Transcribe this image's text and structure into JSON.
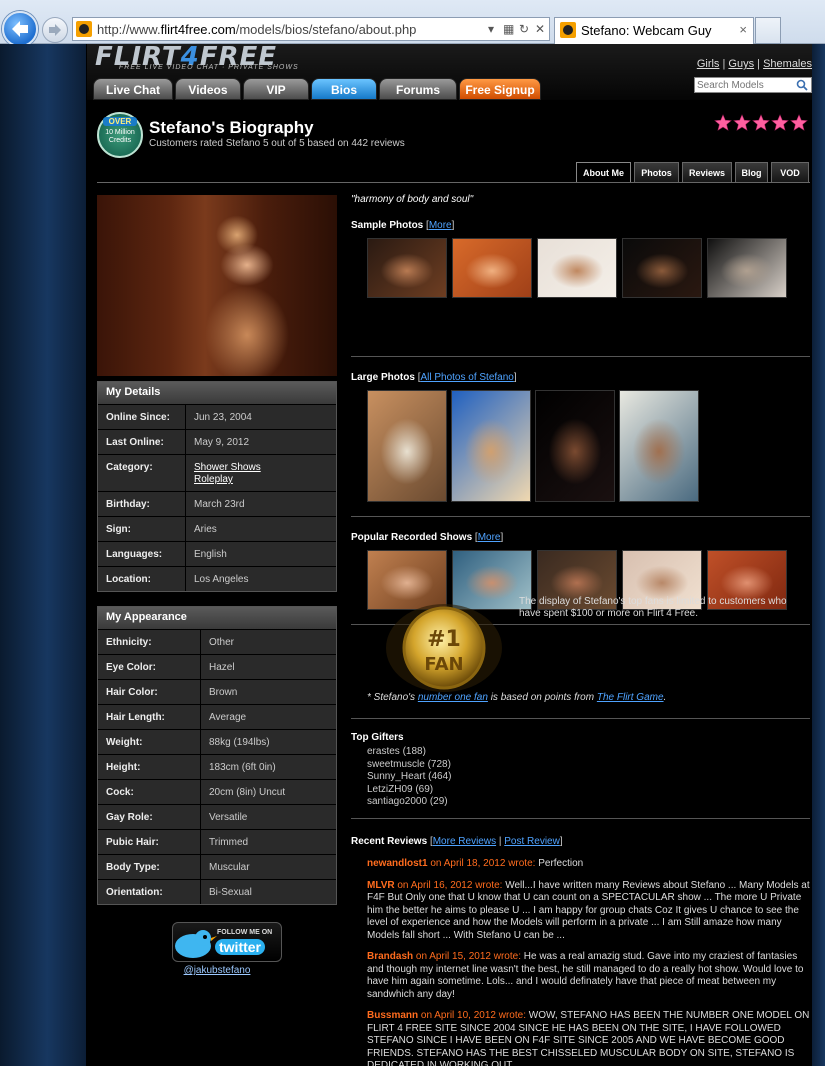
{
  "browser": {
    "url_prefix": "http://www.",
    "url_domain": "flirt4free.com",
    "url_path": "/models/bios/stefano/about.php",
    "tab_title": "Stefano: Webcam Guy",
    "tab_close": "×"
  },
  "site": {
    "logo_main": "FLIRT",
    "logo_four": "4",
    "logo_end": "FREE",
    "tagline": "FREE LIVE VIDEO CHAT · PRIVATE SHOWS",
    "nav": [
      {
        "label": "Live Chat"
      },
      {
        "label": "Videos"
      },
      {
        "label": "VIP"
      },
      {
        "label": "Bios"
      },
      {
        "label": "Forums"
      },
      {
        "label": "Free Signup"
      }
    ],
    "gender_links": [
      "Girls",
      "Guys",
      "Shemales"
    ],
    "gender_sep": "|",
    "search_placeholder": "Search Models"
  },
  "bio": {
    "badge_over": "OVER",
    "badge_credits": "10 Million Credits",
    "title": "Stefano's Biography",
    "subtitle": "Customers rated Stefano 5 out of 5 based on 442 reviews",
    "rating": 5,
    "star_color": "#ff5fa0",
    "tabs": [
      "About Me",
      "Photos",
      "Reviews",
      "Blog",
      "VOD"
    ]
  },
  "details": {
    "heading": "My Details",
    "rows": [
      {
        "label": "Online Since:",
        "value": "Jun 23, 2004"
      },
      {
        "label": "Last Online:",
        "value": "May 9, 2012"
      },
      {
        "label": "Category:",
        "links": [
          "Shower Shows",
          "Roleplay"
        ]
      },
      {
        "label": "Birthday:",
        "value": "March 23rd"
      },
      {
        "label": "Sign:",
        "value": "Aries"
      },
      {
        "label": "Languages:",
        "value": "English"
      },
      {
        "label": "Location:",
        "value": "Los Angeles"
      }
    ]
  },
  "appearance": {
    "heading": "My Appearance",
    "rows": [
      {
        "label": "Ethnicity:",
        "value": "Other"
      },
      {
        "label": "Eye Color:",
        "value": "Hazel"
      },
      {
        "label": "Hair Color:",
        "value": "Brown"
      },
      {
        "label": "Hair Length:",
        "value": "Average"
      },
      {
        "label": "Weight:",
        "value": "88kg (194lbs)"
      },
      {
        "label": "Height:",
        "value": "183cm (6ft 0in)"
      },
      {
        "label": "Cock:",
        "value": "20cm (8in) Uncut"
      },
      {
        "label": "Gay Role:",
        "value": "Versatile"
      },
      {
        "label": "Pubic Hair:",
        "value": "Trimmed"
      },
      {
        "label": "Body Type:",
        "value": "Muscular"
      },
      {
        "label": "Orientation:",
        "value": "Bi-Sexual"
      }
    ]
  },
  "twitter": {
    "follow": "FOLLOW ME ON",
    "word": "twitter",
    "handle": "@jakubstefano"
  },
  "content": {
    "quote": "\"harmony of body and soul\"",
    "sample_label": "Sample Photos",
    "sample_link": "More",
    "large_label": "Large Photos",
    "large_link": "All Photos of Stefano",
    "shows_label": "Popular Recorded Shows",
    "shows_link": "More",
    "bracket_open": "[",
    "bracket_close": "]",
    "fan_medal_top": "#1",
    "fan_medal_bottom": "FAN",
    "fan_text": "The display of Stefano's top fans is limited to customers who have spent $100 or more on Flirt 4 Free.",
    "fan_note_start": "* Stefano's",
    "fan_note_link1": "number one fan",
    "fan_note_mid": "is based on points from",
    "fan_note_link2": "The Flirt Game",
    "fan_note_end": ".",
    "gifters_label": "Top Gifters",
    "gifters": [
      "erastes (188)",
      "sweetmuscle (728)",
      "Sunny_Heart (464)",
      "LetziZH09 (69)",
      "santiago2000 (29)"
    ],
    "reviews_label": "Recent Reviews",
    "reviews_more": "More Reviews",
    "reviews_post": "Post Review",
    "reviews_sep": "|",
    "reviews": [
      {
        "who": "newandlost1",
        "on": "on April 18, 2012 wrote:",
        "text": "Perfection"
      },
      {
        "who": "MLVR",
        "on": "on April 16, 2012 wrote:",
        "text": "Well...I have written many Reviews about Stefano ... Many Models at F4F But Only one that U know that U can count on a SPECTACULAR show ... The more U Private him the better he aims to please U ... I am happy for group chats Coz It gives U chance to see the level of experience and how the Models will perform in a private ... I am Still amaze how many Models fall short ... With Stefano U can be ..."
      },
      {
        "who": "Brandash",
        "on": "on April 15, 2012 wrote:",
        "text": "He was a real amazig stud. Gave into my craziest of fantasies and though my internet line wasn't the best, he still managed to do a really hot show. Would love to have him again sometime. Lols... and I would definately have that piece of meat between my sandwhich any day!"
      },
      {
        "who": "Bussmann",
        "on": "on April 10, 2012 wrote:",
        "text": "WOW, STEFANO HAS BEEN THE NUMBER ONE MODEL ON FLIRT 4 FREE SITE SINCE 2004 SINCE HE HAS BEEN ON THE SITE, I HAVE FOLLOWED STEFANO SINCE I HAVE BEEN ON F4F SITE SINCE 2005 AND WE HAVE BECOME GOOD FRIENDS. STEFANO HAS THE BEST CHISSELED MUSCULAR BODY ON SITE, STEFANO IS DEDICATED IN WORKING OUT"
      }
    ]
  },
  "thumbnails": {
    "sample_count": 5,
    "large_count": 4,
    "shows_count": 5
  }
}
